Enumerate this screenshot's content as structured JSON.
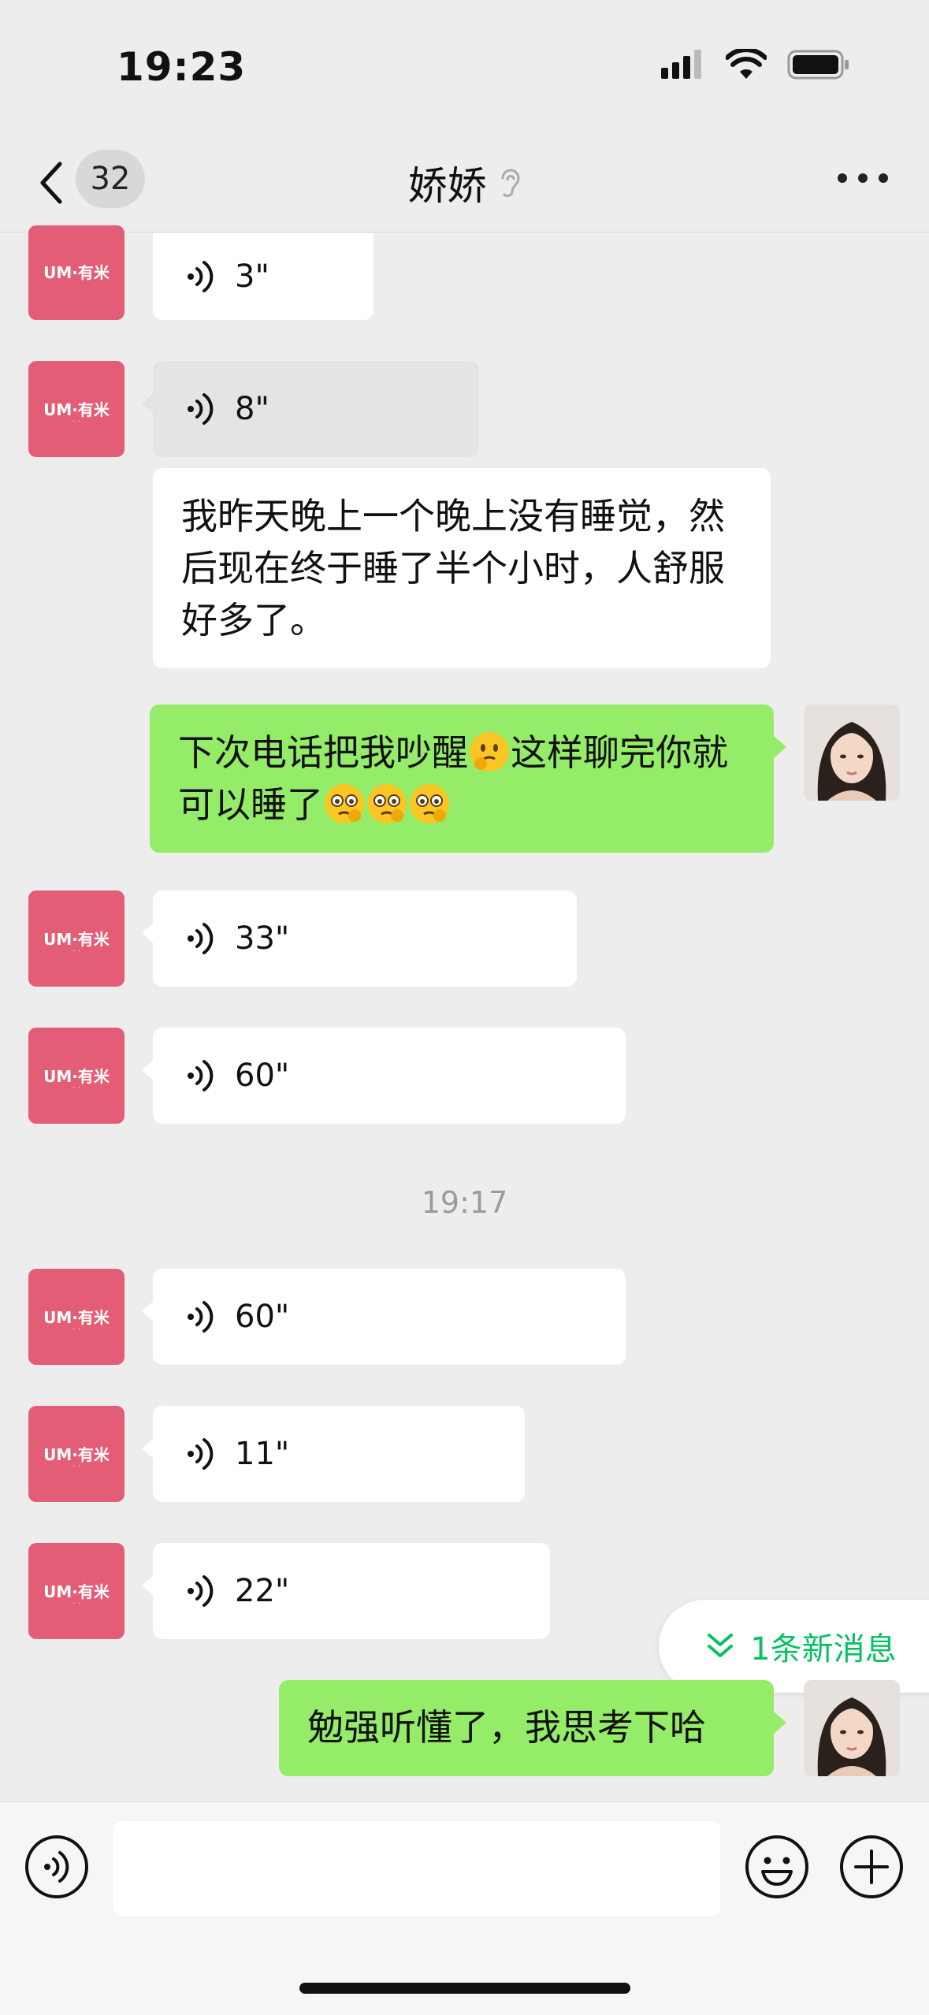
{
  "status": {
    "time": "19:23"
  },
  "nav": {
    "unread_count": "32",
    "title": "娇娇"
  },
  "avatar_logo": {
    "main": "UM·有米",
    "sub": "· ·"
  },
  "messages": {
    "v1": "3\"",
    "v2": "8\"",
    "t1": "我昨天晚上一个晚上没有睡觉，然后现在终于睡了半个小时，人舒服好多了。",
    "t2_part1": "下次电话把我吵醒",
    "t2_part2": "这样聊完你就可以睡了",
    "v3": "33\"",
    "v4": "60\"",
    "timestamp": "19:17",
    "v5": "60\"",
    "v6": "11\"",
    "v7": "22\"",
    "t3": "勉强听懂了，我思考下哈"
  },
  "new_messages": "1条新消息",
  "input": {
    "value": ""
  },
  "colors": {
    "accent": "#07c160",
    "sent_bubble": "#95ec69",
    "avatar_bg": "#e35d76"
  },
  "icons": [
    "signal-icon",
    "wifi-icon",
    "battery-icon",
    "back-arrow-icon",
    "ear-icon",
    "more-icon",
    "voice-wave-icon",
    "double-chevron-down-icon",
    "voice-input-icon",
    "emoji-icon",
    "plus-icon"
  ]
}
